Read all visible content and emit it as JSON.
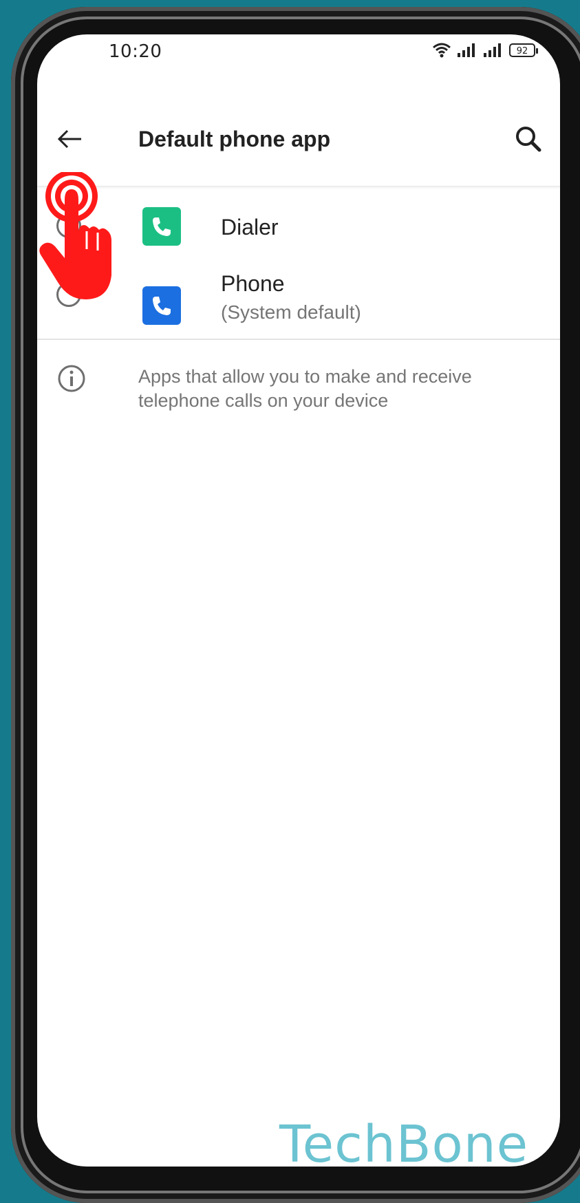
{
  "status_bar": {
    "time": "10:20",
    "battery_level": "92",
    "icons": [
      "wifi-icon",
      "signal-icon",
      "signal-icon",
      "battery-icon"
    ]
  },
  "app_bar": {
    "back_icon": "arrow-left-icon",
    "title": "Default phone app",
    "search_icon": "search-icon"
  },
  "apps": [
    {
      "label": "Dialer",
      "sublabel": "",
      "selected": false,
      "icon": "phone-icon",
      "icon_color": "#1bbf84"
    },
    {
      "label": "Phone",
      "sublabel": "(System default)",
      "selected": true,
      "icon": "phone-icon",
      "icon_color": "#1c6fe0"
    }
  ],
  "info": {
    "icon": "info-icon",
    "text": "Apps that allow you to make and receive telephone calls on your device"
  },
  "overlay": {
    "tap_indicator_icon": "tap-hand-icon",
    "tap_indicator_color": "#ff1a1a"
  },
  "watermark": "TechBone"
}
